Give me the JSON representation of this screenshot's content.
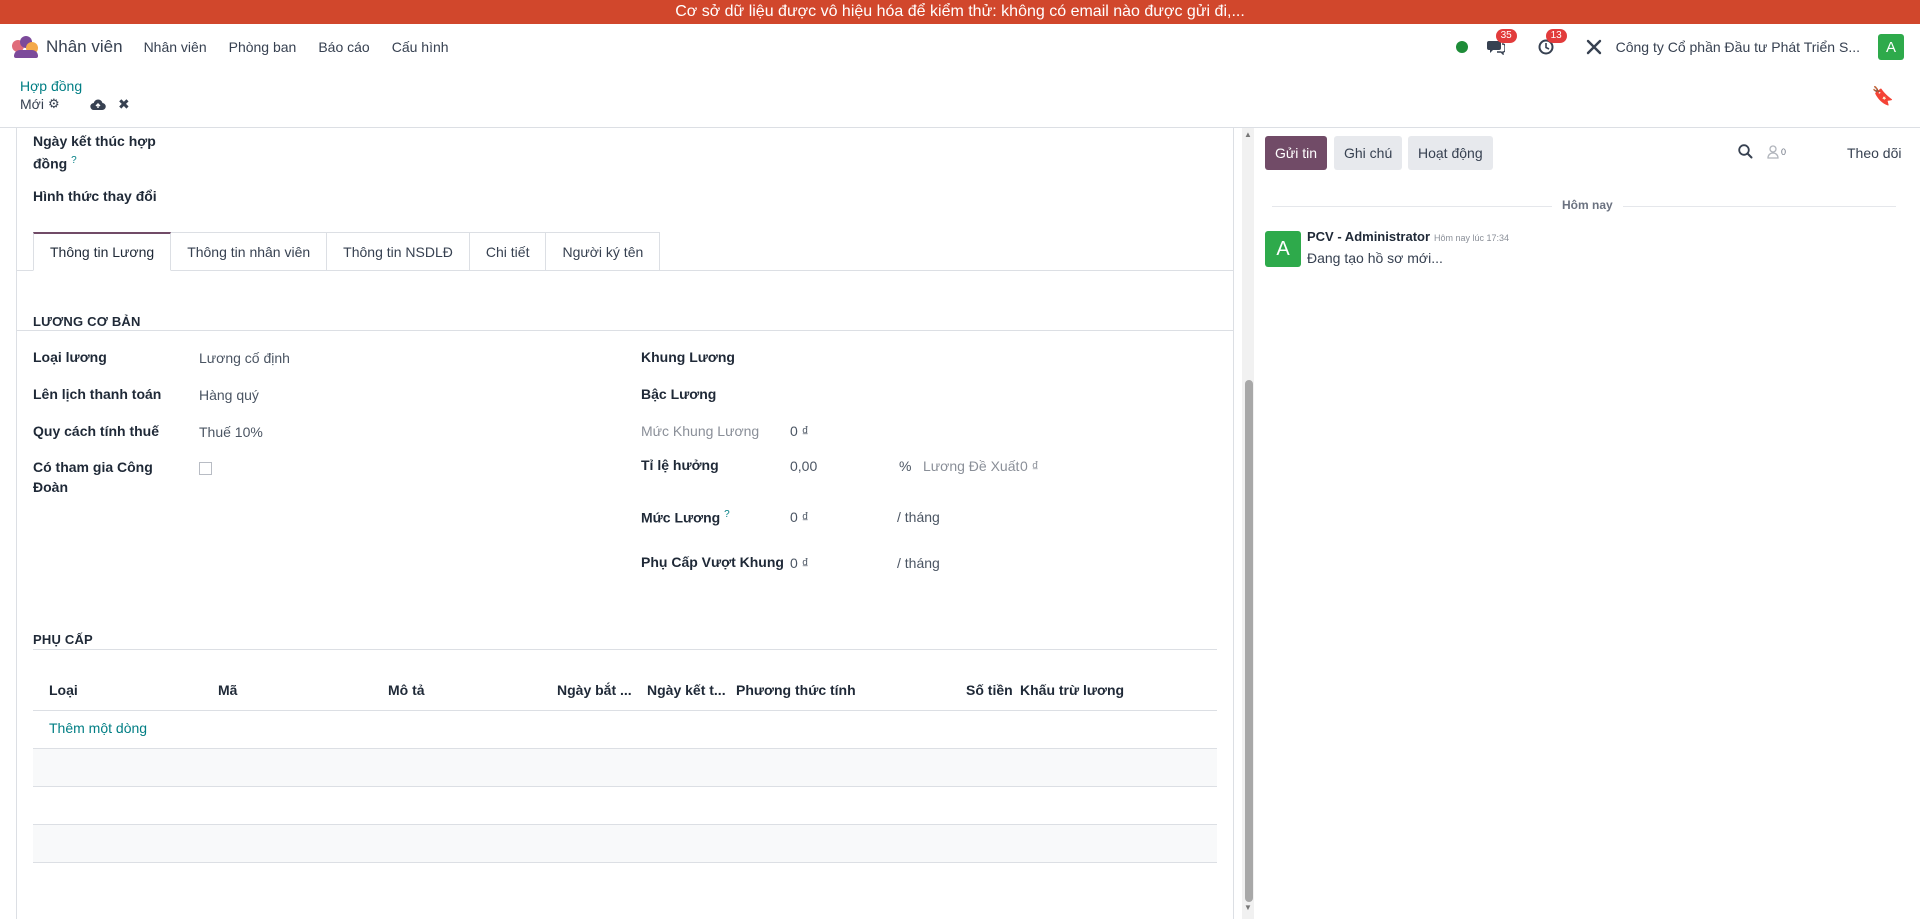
{
  "banner": {
    "text": "Cơ sở dữ liệu được vô hiệu hóa để kiểm thử: không có email nào được gửi đi,..."
  },
  "navbar": {
    "app_name": "Nhân viên",
    "menu": [
      "Nhân viên",
      "Phòng ban",
      "Báo cáo",
      "Cấu hình"
    ],
    "messages_count": "35",
    "activities_count": "13",
    "company": "Công ty Cổ phần Đầu tư Phát Triển S...",
    "user_initial": "A",
    "status_color": "#1e8c38"
  },
  "breadcrumb": {
    "parent": "Hợp đồng",
    "current": "Mới"
  },
  "top_fields": {
    "end_date_label_1": "Ngày kết thúc hợp",
    "end_date_label_2": "đồng",
    "change_type_label": "Hình thức thay đổi"
  },
  "tabs": [
    "Thông tin Lương",
    "Thông tin nhân viên",
    "Thông tin NSDLĐ",
    "Chi tiết",
    "Người ký tên"
  ],
  "salary_section": {
    "title": "LƯƠNG CƠ BẢN",
    "left": {
      "salary_type_label": "Loại lương",
      "salary_type_value": "Lương cố định",
      "pay_schedule_label": "Lên lịch thanh toán",
      "pay_schedule_value": "Hàng quý",
      "tax_rule_label": "Quy cách tính thuế",
      "tax_rule_value": "Thuế 10%",
      "union_label_1": "Có tham gia Công",
      "union_label_2": "Đoàn",
      "union_checked": false
    },
    "right": {
      "frame_label": "Khung Lương",
      "grade_label": "Bậc Lương",
      "frame_level_label": "Mức Khung Lương",
      "frame_level_value": "0 ₫",
      "ratio_label": "Tỉ lệ hưởng",
      "ratio_value": "0,00",
      "ratio_unit": "%",
      "suggested_label": "Lương Đề Xuất",
      "suggested_value": "0 ₫",
      "wage_label": "Mức Lương",
      "wage_value": "0 ₫",
      "wage_unit": "/ tháng",
      "over_frame_label": "Phụ Cấp Vượt Khung",
      "over_frame_value": "0 ₫",
      "over_frame_unit": "/ tháng"
    }
  },
  "allowance_section": {
    "title": "PHỤ CẤP",
    "columns": [
      "Loại",
      "Mã",
      "Mô tả",
      "Ngày bắt ...",
      "Ngày kết t...",
      "Phương thức tính",
      "Số tiền",
      "Khấu trừ lương"
    ],
    "add_line": "Thêm một dòng"
  },
  "chatter": {
    "send_message": "Gửi tin",
    "log_note": "Ghi chú",
    "activities": "Hoạt động",
    "followers_count": "0",
    "follow": "Theo dõi",
    "day_label": "Hôm nay",
    "message": {
      "avatar_initial": "A",
      "author": "PCV - Administrator",
      "time": "Hôm nay lúc 17:34",
      "body": "Đang tạo hồ sơ mới..."
    }
  },
  "colors": {
    "banner": "#d1472c",
    "primary": "#714b67",
    "link": "#017e84",
    "avatar": "#2eaa4b",
    "badge": "#e23c3c"
  }
}
